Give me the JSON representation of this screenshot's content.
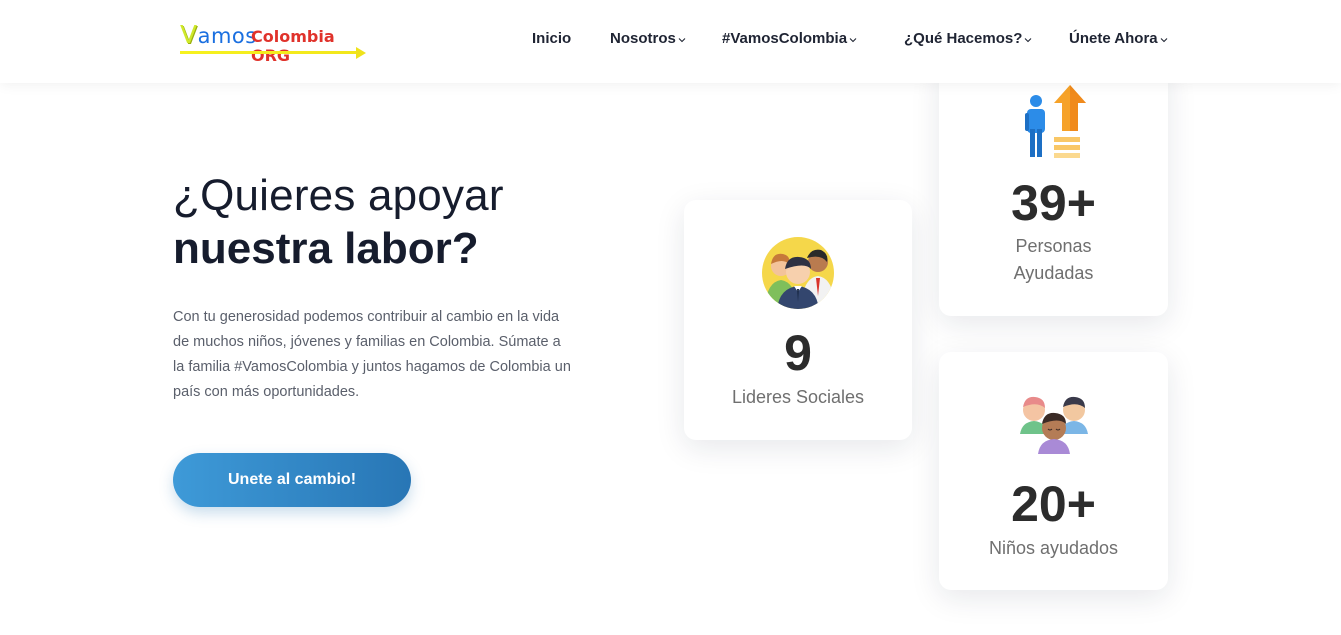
{
  "header": {
    "logo": {
      "word1": "V",
      "word1_rest": "amos",
      "word2": "Colombia ORG"
    },
    "nav": [
      {
        "label": "Inicio",
        "has_dropdown": false
      },
      {
        "label": "Nosotros",
        "has_dropdown": true
      },
      {
        "label": "#VamosColombia",
        "has_dropdown": true
      },
      {
        "label": "¿Qué Hacemos?",
        "has_dropdown": true
      },
      {
        "label": "Únete Ahora",
        "has_dropdown": true
      }
    ]
  },
  "hero": {
    "title_light": "¿Quieres apoyar",
    "title_bold": "nuestra labor?",
    "paragraph": "Con tu generosidad podemos contribuir al cambio en la vida de muchos niños, jóvenes y familias en Colombia. Súmate a la familia #VamosColombia y juntos hagamos de Colombia un país con más oportunidades.",
    "cta_label": "Unete al cambio!"
  },
  "stats": {
    "lideres": {
      "value": "9",
      "label": "Lideres Sociales",
      "icon": "leaders-group-icon"
    },
    "personas": {
      "value": "39+",
      "label_line1": "Personas",
      "label_line2": "Ayudadas",
      "icon": "person-growth-arrow-icon"
    },
    "ninos": {
      "value": "20+",
      "label": "Niños ayudados",
      "icon": "children-group-icon"
    }
  },
  "colors": {
    "cta_gradient_start": "#3e9ad8",
    "cta_gradient_end": "#2876b5",
    "heading": "#161c2d",
    "logo_yellow": "#cfe82a",
    "logo_red": "#e0322b"
  }
}
